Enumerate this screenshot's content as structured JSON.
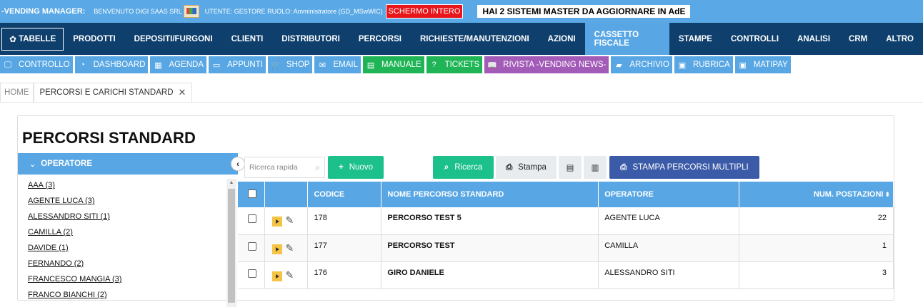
{
  "topbar": {
    "app_title": "-VENDING MANAGER:",
    "welcome": "BENVENUTO DIGI SAAS SRL",
    "user_info": "UTENTE: GESTORE RUOLO: Amministratore (GD_MSwWIC)",
    "fullscreen_label": "SCHERMO INTERO",
    "alert": "HAI 2 SISTEMI MASTER DA AGGIORNARE IN AdE"
  },
  "mainnav": {
    "items": [
      {
        "label": "TABELLE",
        "icon": "gear-icon"
      },
      {
        "label": "PRODOTTI"
      },
      {
        "label": "DEPOSITI/FURGONI"
      },
      {
        "label": "CLIENTI"
      },
      {
        "label": "DISTRIBUTORI"
      },
      {
        "label": "PERCORSI"
      },
      {
        "label": "RICHIESTE/MANUTENZIONI"
      },
      {
        "label": "AZIONI"
      },
      {
        "label": "CASSETTO FISCALE",
        "active": true
      },
      {
        "label": "STAMPE"
      },
      {
        "label": "CONTROLLI"
      },
      {
        "label": "ANALISI"
      },
      {
        "label": "CRM"
      },
      {
        "label": "ALTRO"
      }
    ]
  },
  "shortcuts": [
    {
      "label": "CONTROLLO",
      "icon": "monitor-icon",
      "glyph": "🖵",
      "color": "blue"
    },
    {
      "label": "DASHBOARD",
      "icon": "dashboard-icon",
      "glyph": "◔",
      "color": "blue"
    },
    {
      "label": "AGENDA",
      "icon": "calendar-icon",
      "glyph": "▦",
      "color": "blue"
    },
    {
      "label": "APPUNTI",
      "icon": "clipboard-icon",
      "glyph": "▭",
      "color": "blue"
    },
    {
      "label": "SHOP",
      "icon": "cart-icon",
      "glyph": "🛒",
      "color": "blue"
    },
    {
      "label": "EMAIL",
      "icon": "envelope-icon",
      "glyph": "✉",
      "color": "blue"
    },
    {
      "label": "MANUALE",
      "icon": "book-icon",
      "glyph": "▤",
      "color": "green"
    },
    {
      "label": "TICKETS",
      "icon": "help-icon",
      "glyph": "?",
      "color": "green"
    },
    {
      "label": "RIVISTA -VENDING NEWS-",
      "icon": "open-book-icon",
      "glyph": "📖",
      "color": "purple"
    },
    {
      "label": "ARCHIVIO",
      "icon": "folder-icon",
      "glyph": "▰",
      "color": "blue"
    },
    {
      "label": "RUBRICA",
      "icon": "contact-card-icon",
      "glyph": "▣",
      "color": "blue"
    },
    {
      "label": "MATIPAY",
      "icon": "contact-card-icon",
      "glyph": "▣",
      "color": "blue"
    }
  ],
  "tabs": [
    {
      "label": "HOME"
    },
    {
      "label": "PERCORSI E CARICHI STANDARD",
      "close": "✕",
      "active": true
    }
  ],
  "panel": {
    "title": "PERCORSI STANDARD",
    "operator_header": "OPERATORE",
    "operators": [
      "AAA (3)",
      "AGENTE LUCA (3)",
      "ALESSANDRO SITI (1)",
      "CAMILLA (2)",
      "DAVIDE (1)",
      "FERNANDO (2)",
      "FRANCESCO MANGIA (3)",
      "FRANCO BIANCHI (2)"
    ],
    "search_placeholder": "Ricerca rapida",
    "buttons": {
      "new": "Nuovo",
      "search": "Ricerca",
      "print": "Stampa",
      "multi_print": "STAMPA PERCORSI MULTIPLI"
    }
  },
  "table": {
    "columns": [
      "",
      "",
      "CODICE",
      "NOME PERCORSO STANDARD",
      "OPERATORE",
      "NUM. POSTAZIONI"
    ],
    "rows": [
      {
        "code": "178",
        "name": "PERCORSO TEST 5",
        "operator": "AGENTE LUCA",
        "stations": "22"
      },
      {
        "code": "177",
        "name": "PERCORSO TEST",
        "operator": "CAMILLA",
        "stations": "1"
      },
      {
        "code": "176",
        "name": "GIRO DANIELE",
        "operator": "ALESSANDRO SITI",
        "stations": "3"
      }
    ]
  }
}
